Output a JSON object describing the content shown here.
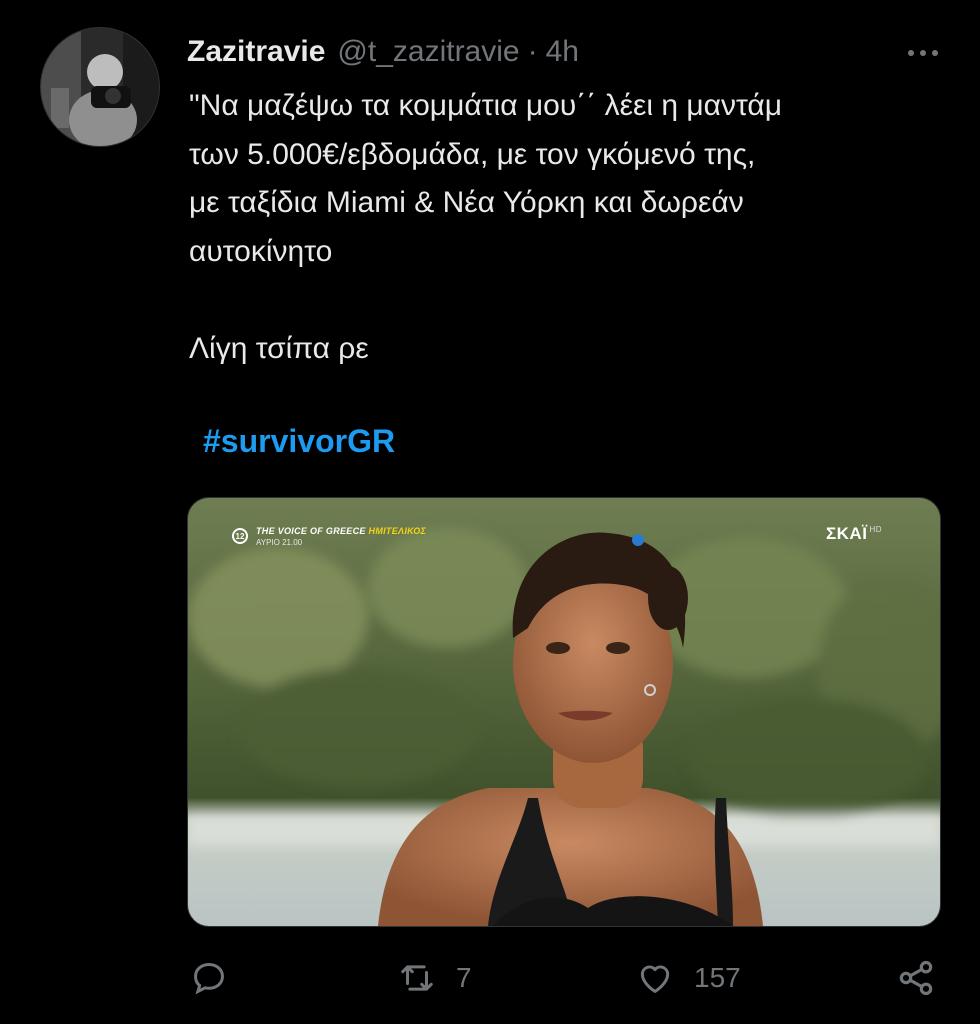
{
  "author": {
    "display_name": "Zazitravie",
    "handle": "@t_zazitravie",
    "separator": "·",
    "time": "4h"
  },
  "tweet": {
    "text": "\"Να μαζέψω τα κομμάτια μου΄΄ λέει η μαντάμ\nτων 5.000€/εβδομάδα, με τον γκόμενό της,\nμε ταξίδια Miami & Νέα Υόρκη και δωρεάν\nαυτοκίνητο\n\nΛίγη τσίπα ρε",
    "hashtag": "#survivorGR"
  },
  "media": {
    "overlay_show": "THE VOICE OF GREECE",
    "overlay_highlight": "ΗΜΙΤΕΛΙΚΟΣ",
    "overlay_time": "ΑΥΡΙΟ 21.00",
    "overlay_badge": "12",
    "channel": "ΣΚΑΪ",
    "channel_suffix": "HD"
  },
  "actions": {
    "replies": "",
    "retweets": "7",
    "likes": "157"
  },
  "colors": {
    "background": "#000000",
    "text": "#e7e9ea",
    "muted": "#71767b",
    "accent": "#1d9bf0"
  },
  "icons": {
    "more": "more-horizontal-icon",
    "reply": "reply-bubble-icon",
    "retweet": "retweet-icon",
    "like": "heart-icon",
    "share": "share-icon"
  }
}
